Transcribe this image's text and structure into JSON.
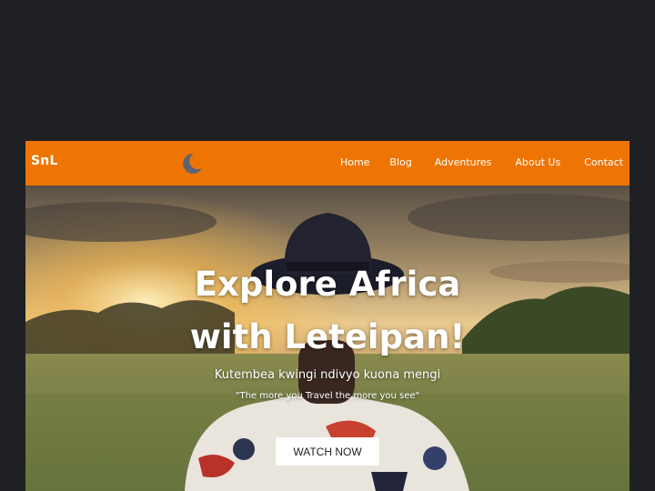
{
  "navbar": {
    "logo": "SnL",
    "theme_toggle_icon": "moon-icon",
    "links": [
      "Home",
      "Blog",
      "Adventures",
      "About Us",
      "Contact"
    ]
  },
  "hero": {
    "title_line1": "Explore Africa",
    "title_line2": "with Leteipan!",
    "subtitle": "Kutembea kwingi ndivyo kuona mengi",
    "quote": "\"The more you Travel the more you see\"",
    "cta_label": "WATCH NOW"
  },
  "colors": {
    "page_background": "#1f2023",
    "navbar_background": "#ee7504",
    "text": "#ffffff",
    "button_background": "#ffffff"
  }
}
